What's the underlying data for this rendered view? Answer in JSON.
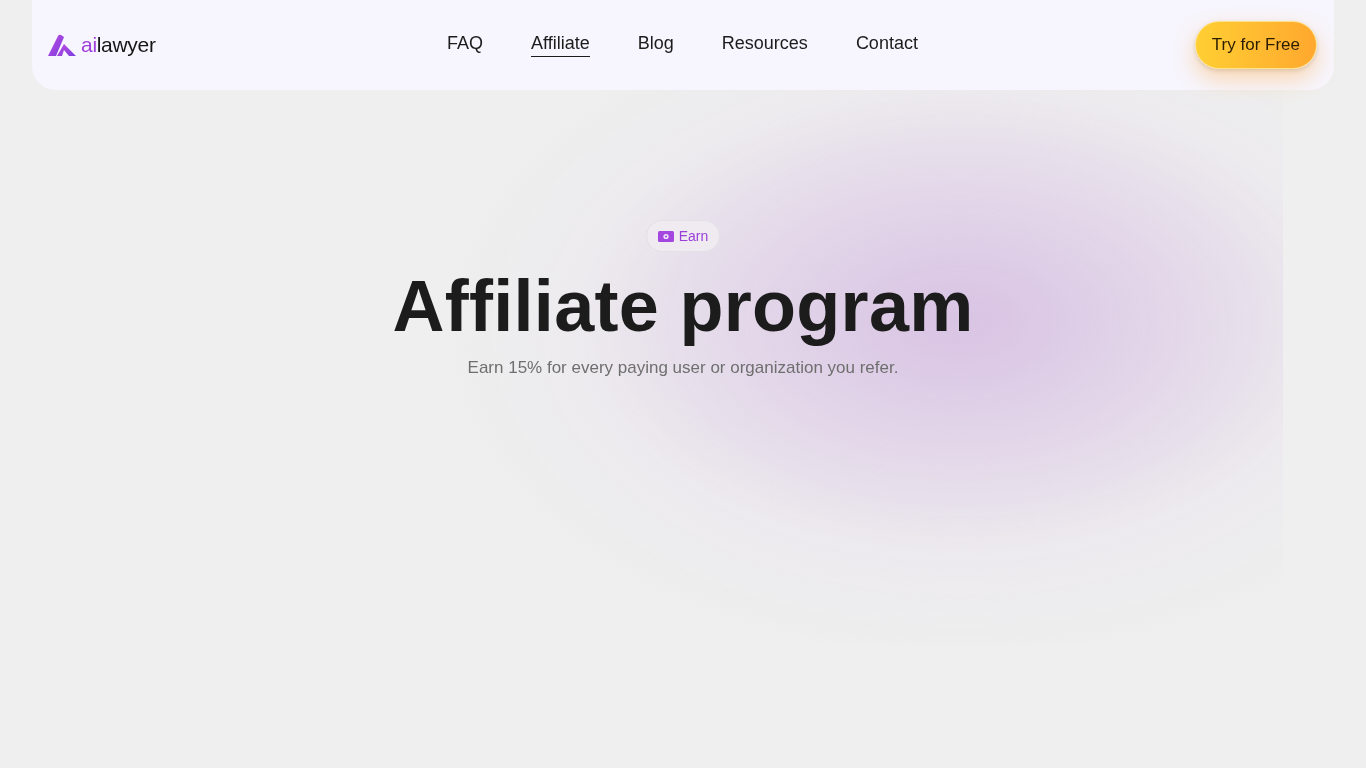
{
  "header": {
    "logo": {
      "accent": "ai",
      "text": "lawyer"
    },
    "nav": [
      {
        "label": "FAQ",
        "selected": false
      },
      {
        "label": "Affiliate",
        "selected": true
      },
      {
        "label": "Blog",
        "selected": false
      },
      {
        "label": "Resources",
        "selected": false
      },
      {
        "label": "Contact",
        "selected": false
      }
    ],
    "cta": "Try for Free"
  },
  "hero": {
    "badge": "Earn",
    "title": "Affiliate program",
    "subtitle": "Earn 15% for every paying user or organization you refer."
  }
}
